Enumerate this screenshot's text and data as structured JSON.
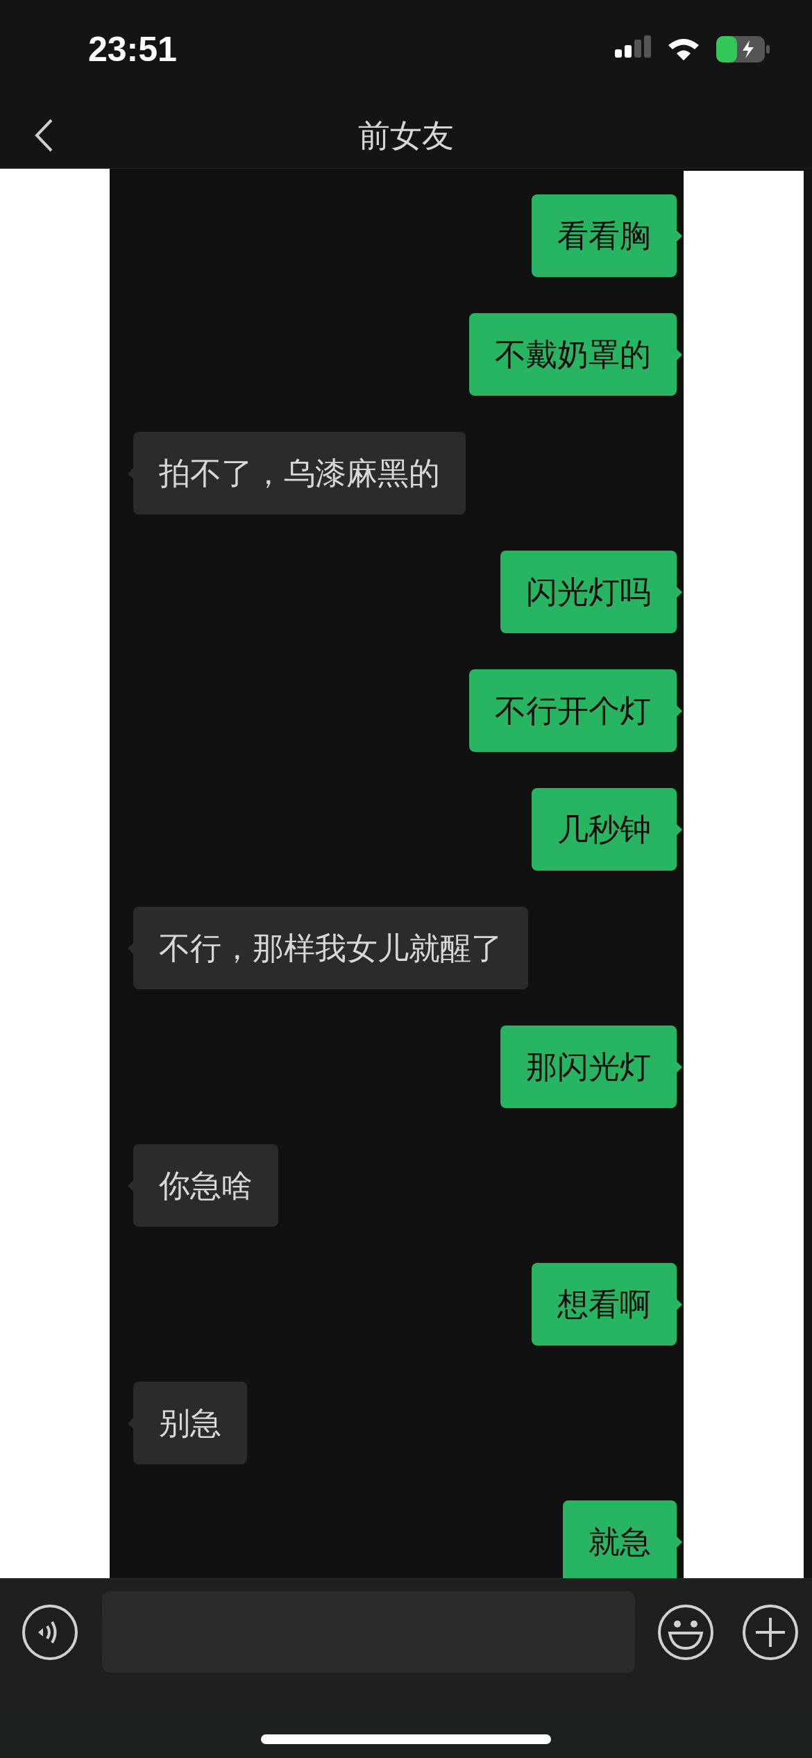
{
  "status_bar": {
    "time": "23:51"
  },
  "header": {
    "title": "前女友"
  },
  "messages": [
    {
      "kind": "sent",
      "text": "看看胸"
    },
    {
      "kind": "sent",
      "text": "不戴奶罩的"
    },
    {
      "kind": "received",
      "text": "拍不了，乌漆麻黑的"
    },
    {
      "kind": "sent",
      "text": "闪光灯吗"
    },
    {
      "kind": "sent",
      "text": "不行开个灯"
    },
    {
      "kind": "sent",
      "text": "几秒钟"
    },
    {
      "kind": "received",
      "text": "不行，那样我女儿就醒了"
    },
    {
      "kind": "sent",
      "text": "那闪光灯"
    },
    {
      "kind": "received",
      "text": "你急啥"
    },
    {
      "kind": "sent",
      "text": "想看啊"
    },
    {
      "kind": "received",
      "text": "别急"
    },
    {
      "kind": "sent",
      "text": "就急"
    }
  ]
}
